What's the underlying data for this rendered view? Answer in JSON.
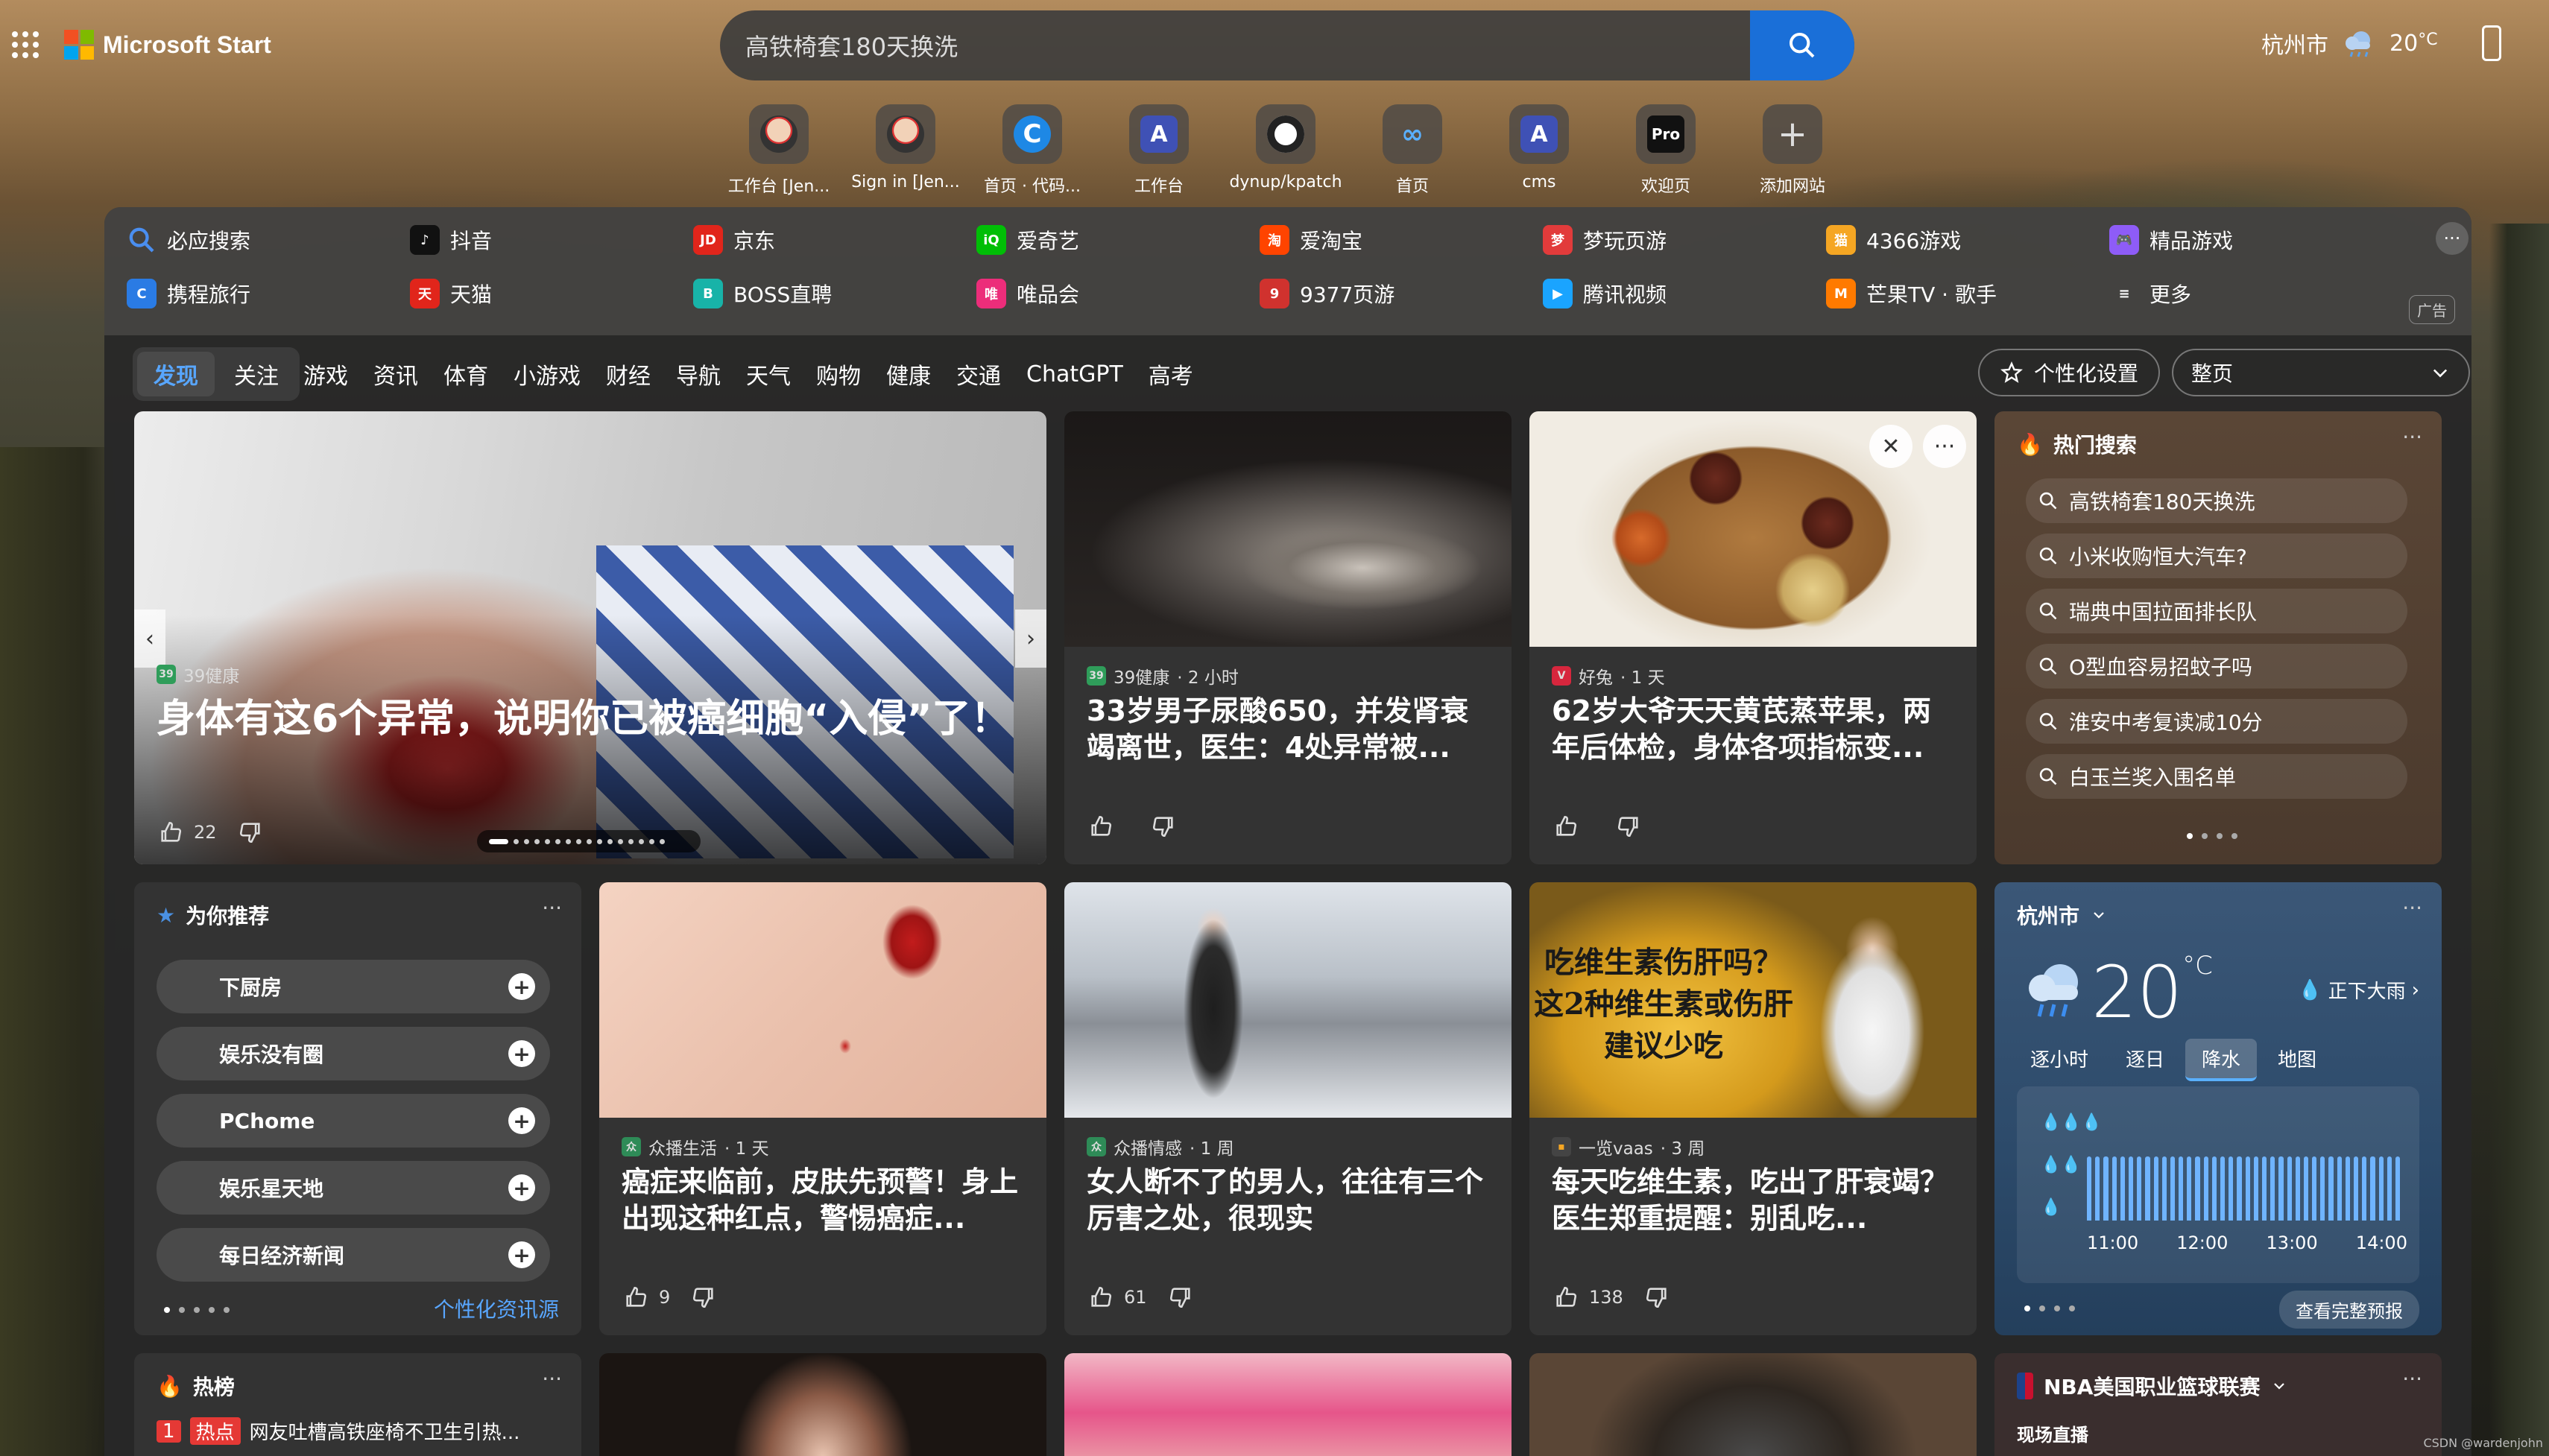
{
  "brand": {
    "name": "Microsoft Start"
  },
  "search": {
    "value": "高铁椅套180天换洗"
  },
  "weather_top": {
    "city": "杭州市",
    "temp": "20",
    "unit": "°C"
  },
  "quicklinks": [
    {
      "label": "工作台 [Jen...",
      "icon": "jenkins-icon",
      "kind": "jenkins"
    },
    {
      "label": "Sign in [Jen...",
      "icon": "jenkins-icon",
      "kind": "jenkins"
    },
    {
      "label": "首页 · 代码...",
      "icon": "code-c-icon",
      "kind": "c"
    },
    {
      "label": "工作台",
      "icon": "a-logo-icon",
      "kind": "a"
    },
    {
      "label": "dynup/kpatch",
      "icon": "github-icon",
      "kind": "github"
    },
    {
      "label": "首页",
      "icon": "meta-icon",
      "kind": "meta"
    },
    {
      "label": "cms",
      "icon": "a-logo-icon",
      "kind": "a"
    },
    {
      "label": "欢迎页",
      "icon": "pro-icon",
      "kind": "pro"
    },
    {
      "label": "添加网站",
      "icon": "plus-icon",
      "kind": "plus"
    }
  ],
  "sites": {
    "row1": [
      {
        "label": "必应搜索",
        "icon": "search-icon",
        "color": "#4a8ef0",
        "glyph": ""
      },
      {
        "label": "抖音",
        "icon": "douyin-icon",
        "color": "#111111",
        "glyph": "♪"
      },
      {
        "label": "京东",
        "icon": "jd-icon",
        "color": "#e1251b",
        "glyph": "JD"
      },
      {
        "label": "爱奇艺",
        "icon": "iqiyi-icon",
        "color": "#00be06",
        "glyph": "iQ"
      },
      {
        "label": "爱淘宝",
        "icon": "taobao-icon",
        "color": "#ff4400",
        "glyph": "淘"
      },
      {
        "label": "梦玩页游",
        "icon": "mengwan-icon",
        "color": "#e23b3b",
        "glyph": "梦"
      },
      {
        "label": "4366游戏",
        "icon": "cat-game-icon",
        "color": "#f5a623",
        "glyph": "猫"
      },
      {
        "label": "精品游戏",
        "icon": "gamepad-icon",
        "color": "#8e5cf7",
        "glyph": "🎮"
      }
    ],
    "row2": [
      {
        "label": "携程旅行",
        "icon": "ctrip-icon",
        "color": "#2a7be4",
        "glyph": "C"
      },
      {
        "label": "天猫",
        "icon": "tmall-icon",
        "color": "#e1251b",
        "glyph": "天"
      },
      {
        "label": "BOSS直聘",
        "icon": "boss-icon",
        "color": "#18b3a8",
        "glyph": "B"
      },
      {
        "label": "唯品会",
        "icon": "vip-icon",
        "color": "#ec2d7a",
        "glyph": "唯"
      },
      {
        "label": "9377页游",
        "icon": "9377-icon",
        "color": "#d0322e",
        "glyph": "9"
      },
      {
        "label": "腾讯视频",
        "icon": "tencent-video-icon",
        "color": "#1aa4ff",
        "glyph": "▶"
      },
      {
        "label": "芒果TV · 歌手",
        "icon": "mango-icon",
        "color": "#ff7a00",
        "glyph": "M"
      },
      {
        "label": "更多",
        "icon": "menu-icon",
        "color": "transparent",
        "glyph": "≡"
      }
    ],
    "more": "···",
    "ad": "广告"
  },
  "nav": {
    "seg": [
      "发现",
      "关注"
    ],
    "items": [
      "游戏",
      "资讯",
      "体育",
      "小游戏",
      "财经",
      "导航",
      "天气",
      "购物",
      "健康",
      "交通",
      "ChatGPT",
      "高考"
    ],
    "personalize": "个性化设置",
    "page_select": "整页"
  },
  "hero": {
    "source": "39健康",
    "headline": "身体有这6个异常，说明你已被癌细胞“入侵”了！",
    "likes": "22"
  },
  "cards_row1": [
    {
      "source": "39健康",
      "time": "· 2 小时",
      "headline": "33岁男子尿酸650，并发肾衰竭离世，医生：4处异常被...",
      "likes": ""
    },
    {
      "source": "好兔",
      "time": "· 1 天",
      "headline": "62岁大爷天天黄芪蒸苹果，两年后体检，身体各项指标变...",
      "likes": ""
    }
  ],
  "hot_search": {
    "title": "热门搜索",
    "items": [
      "高铁椅套180天换洗",
      "小米收购恒大汽车?",
      "瑞典中国拉面排长队",
      "O型血容易招蚊子吗",
      "淮安中考复读减10分",
      "白玉兰奖入围名单"
    ]
  },
  "recommend": {
    "title": "为你推荐",
    "items": [
      "下厨房",
      "娱乐没有圈",
      "PChome",
      "娱乐星天地",
      "每日经济新闻"
    ],
    "link": "个性化资讯源"
  },
  "cards_row2": [
    {
      "source": "众播生活",
      "time": "· 1 天",
      "headline": "癌症来临前，皮肤先预警！身上出现这种红点，警惕癌症...",
      "likes": "9"
    },
    {
      "source": "众播情感",
      "time": "· 1 周",
      "headline": "女人断不了的男人，往往有三个厉害之处，很现实",
      "likes": "61"
    },
    {
      "source": "一览vaas",
      "time": "· 3 周",
      "headline": "每天吃维生素，吃出了肝衰竭？医生郑重提醒：别乱吃...",
      "likes": "138"
    }
  ],
  "vitamin_overlay": [
    "吃维生素伤肝吗？",
    "这2种维生素或伤肝",
    "建议少吃"
  ],
  "weather": {
    "city": "杭州市",
    "temp": "20",
    "unit": "°C",
    "cond": "正下大雨",
    "tabs": [
      "逐小时",
      "逐日",
      "降水",
      "地图"
    ],
    "times": [
      "11:00",
      "12:00",
      "13:00",
      "14:00"
    ],
    "link": "查看完整预报"
  },
  "bottom": {
    "hot_title": "热榜",
    "hot_item_rank": "1",
    "hot_item_tag": "热点",
    "hot_item": "网友吐槽高铁座椅不卫生引热...",
    "nba_title": "NBA美国职业篮球联赛",
    "nba_sub": "现场直播"
  },
  "footer": "CSDN @wardenjohn"
}
